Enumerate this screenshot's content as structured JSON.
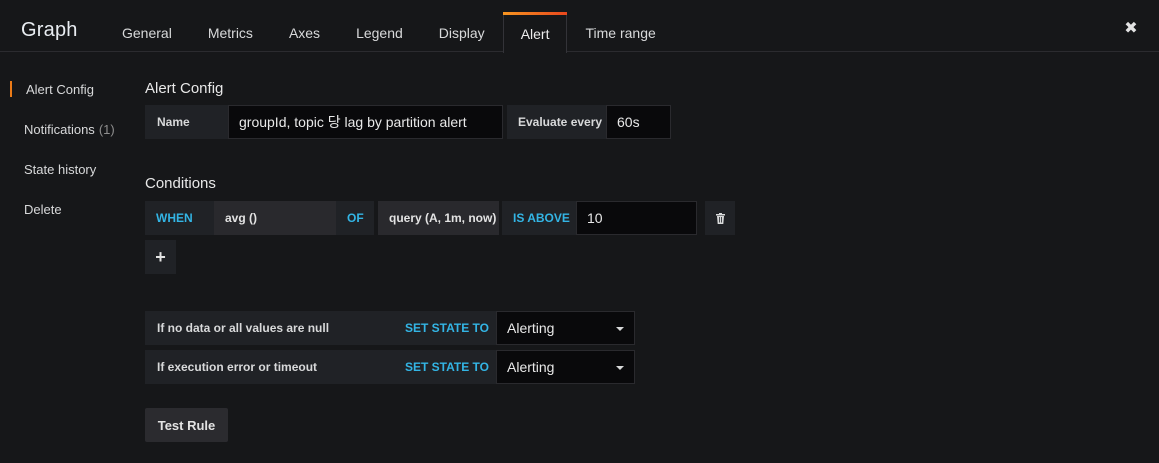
{
  "header": {
    "title": "Graph",
    "tabs": [
      "General",
      "Metrics",
      "Axes",
      "Legend",
      "Display",
      "Alert",
      "Time range"
    ],
    "active_tab": "Alert",
    "close_glyph": "✖"
  },
  "sidebar": {
    "items": [
      {
        "label": "Alert Config"
      },
      {
        "label": "Notifications",
        "count": "(1)"
      },
      {
        "label": "State history"
      },
      {
        "label": "Delete"
      }
    ]
  },
  "alert_config": {
    "title": "Alert Config",
    "name_label": "Name",
    "name_value": "groupId, topic 당 lag by partition alert",
    "evaluate_label": "Evaluate every",
    "evaluate_value": "60s"
  },
  "conditions": {
    "title": "Conditions",
    "when": "WHEN",
    "reducer": "avg ()",
    "of": "OF",
    "query": "query (A, 1m, now)",
    "evaluator": "IS ABOVE",
    "threshold": "10",
    "add_glyph": "+"
  },
  "no_data": {
    "label": "If no data or all values are null",
    "set_state": "SET STATE TO",
    "value": "Alerting"
  },
  "exec_error": {
    "label": "If execution error or timeout",
    "set_state": "SET STATE TO",
    "value": "Alerting"
  },
  "test_rule": {
    "label": "Test Rule"
  },
  "colors": {
    "accent_gradient_start": "#f79520",
    "accent_gradient_end": "#e8471d",
    "keyword": "#33b5e5",
    "background": "#161719"
  },
  "icons": {
    "close": "close-icon",
    "delete": "trash-icon",
    "add": "plus-icon",
    "dropdown": "caret-down-icon"
  }
}
